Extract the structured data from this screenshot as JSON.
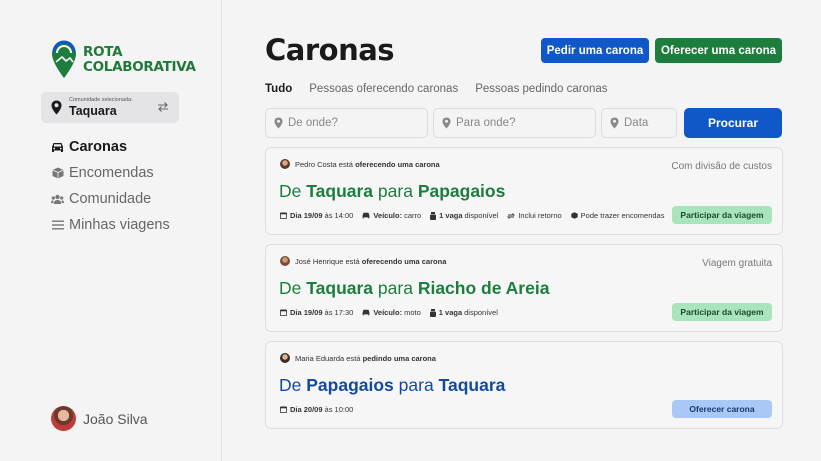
{
  "sidebar": {
    "logo": {
      "line1": "ROTA",
      "line2": "COLABORATIVA"
    },
    "community": {
      "caption": "Comunidade selecionada:",
      "name": "Taquara"
    },
    "nav": [
      {
        "label": "Caronas",
        "icon": "car-icon",
        "active": true
      },
      {
        "label": "Encomendas",
        "icon": "box-icon",
        "active": false
      },
      {
        "label": "Comunidade",
        "icon": "users-icon",
        "active": false
      },
      {
        "label": "Minhas viagens",
        "icon": "list-icon",
        "active": false
      }
    ],
    "user": {
      "name": "João Silva"
    }
  },
  "header": {
    "title": "Caronas",
    "ask_button": "Pedir uma carona",
    "offer_button": "Oferecer uma carona"
  },
  "tabs": [
    "Tudo",
    "Pessoas oferecendo caronas",
    "Pessoas pedindo caronas"
  ],
  "search": {
    "from_placeholder": "De onde?",
    "to_placeholder": "Para onde?",
    "date_placeholder": "Data",
    "button": "Procurar"
  },
  "rides": [
    {
      "person": "Pedro Costa",
      "verb_pre": "está",
      "verb": "oferecendo uma carona",
      "tag": "Com divisão de custos",
      "de": "De",
      "from": "Taquara",
      "para": "para",
      "to": "Papagaios",
      "date_label": "Dia 19/09",
      "time": "às 14:00",
      "vehicle_label": "Veículo:",
      "vehicle": "carro",
      "seats_label": "1 vaga",
      "seats_suffix": "disponível",
      "extra1": "Inclui retorno",
      "extra2": "Pode trazer encomendas",
      "action": "Participar da viagem"
    },
    {
      "person": "José Henrique",
      "verb_pre": "está",
      "verb": "oferecendo uma carona",
      "tag": "Viagem gratuita",
      "de": "De",
      "from": "Taquara",
      "para": "para",
      "to": "Riacho de Areia",
      "date_label": "Dia 19/09",
      "time": "às 17:30",
      "vehicle_label": "Veículo:",
      "vehicle": "moto",
      "seats_label": "1 vaga",
      "seats_suffix": "disponível",
      "action": "Participar da viagem"
    },
    {
      "person": "Maria Eduarda",
      "verb_pre": "está",
      "verb": "pedindo uma carona",
      "de": "De",
      "from": "Papagaios",
      "para": "para",
      "to": "Taquara",
      "date_label": "Dia 20/09",
      "time": "às 10:00",
      "action": "Oferecer carona"
    }
  ],
  "colors": {
    "green": "#1c7d3c",
    "blue": "#1057c8",
    "route_blue": "#134a9e"
  }
}
